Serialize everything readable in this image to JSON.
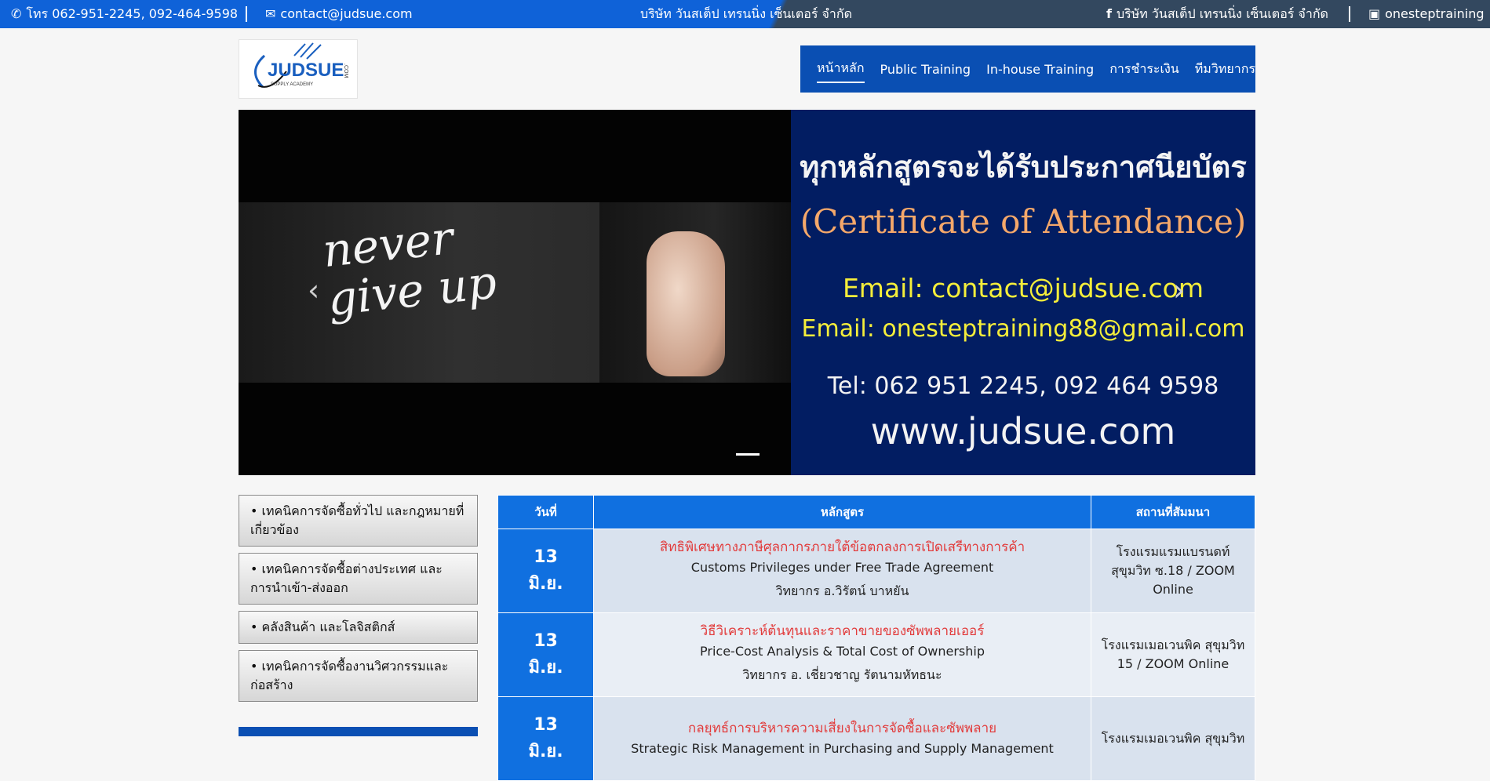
{
  "topbar": {
    "phone": "โทร 062-951-2245, 092-464-9598",
    "email": "contact@judsue.com",
    "company_center": "บริษัท วันสเต็ป เทรนนิ่ง เซ็นเตอร์ จำกัด",
    "facebook": "บริษัท วันสเต็ป เทรนนิ่ง เซ็นเตอร์ จำกัด",
    "line": "onesteptraining"
  },
  "logo": {
    "text": "JUDSUE",
    "sub": "SUPPLY ACADEMY",
    "suffix": ".COM"
  },
  "nav": {
    "items": [
      "หน้าหลัก",
      "Public Training",
      "In-house Training",
      "การชำระเงิน",
      "ทีมวิทยากร"
    ]
  },
  "hero": {
    "left_text": "never give up",
    "thai_heading": "ทุกหลักสูตรจะได้รับประกาศนียบัตร",
    "certificate": "(Certificate of Attendance)",
    "email1": "Email: contact@judsue.com",
    "email2": "Email: onesteptraining88@gmail.com",
    "tel": "Tel: 062 951 2245, 092 464 9598",
    "website": "www.judsue.com",
    "prev_arrow": "‹",
    "next_arrow": "›"
  },
  "sidebar": {
    "items": [
      "• เทคนิคการจัดซื้อทั่วไป และกฎหมายที่เกี่ยวข้อง",
      "• เทคนิคการจัดซื้อต่างประเทศ และการนำเข้า-ส่งออก",
      "• คลังสินค้า และโลจิสติกส์",
      "• เทคนิคการจัดซื้องานวิศวกรรมและก่อสร้าง"
    ]
  },
  "schedule": {
    "headers": [
      "วันที่",
      "หลักสูตร",
      "สถานที่สัมมนา"
    ],
    "rows": [
      {
        "day": "13",
        "month": "มิ.ย.",
        "title_th": "สิทธิพิเศษทางภาษีศุลกากรภายใต้ข้อตกลงการเปิดเสรีทางการค้า",
        "title_en": "Customs Privileges under Free Trade Agreement",
        "speaker": "วิทยากร อ.วิรัตน์ บาหยัน",
        "venue": "โรงแรมแรมแบรนดท์ สุขุมวิท ซ.18 / ZOOM Online"
      },
      {
        "day": "13",
        "month": "มิ.ย.",
        "title_th": "วิธีวิเคราะห์ต้นทุนและราคาขายของซัพพลายเออร์",
        "title_en": "Price-Cost Analysis & Total Cost of Ownership",
        "speaker": "วิทยากร อ. เชี่ยวชาญ รัตนามหัทธนะ",
        "venue": "โรงแรมเมอเวนพิค สุขุมวิท 15 / ZOOM Online"
      },
      {
        "day": "13",
        "month": "มิ.ย.",
        "title_th": "กลยุทธ์การบริหารความเสี่ยงในการจัดซื้อและซัพพลาย",
        "title_en": "Strategic Risk Management in Purchasing and Supply Management",
        "speaker": "",
        "venue": "โรงแรมเมอเวนพิค สุขุมวิท"
      }
    ]
  },
  "colors": {
    "primary_blue": "#0a4fb3",
    "header_blue": "#1070e0",
    "accent_red": "#e23b3b",
    "banner_navy": "#021d62"
  }
}
